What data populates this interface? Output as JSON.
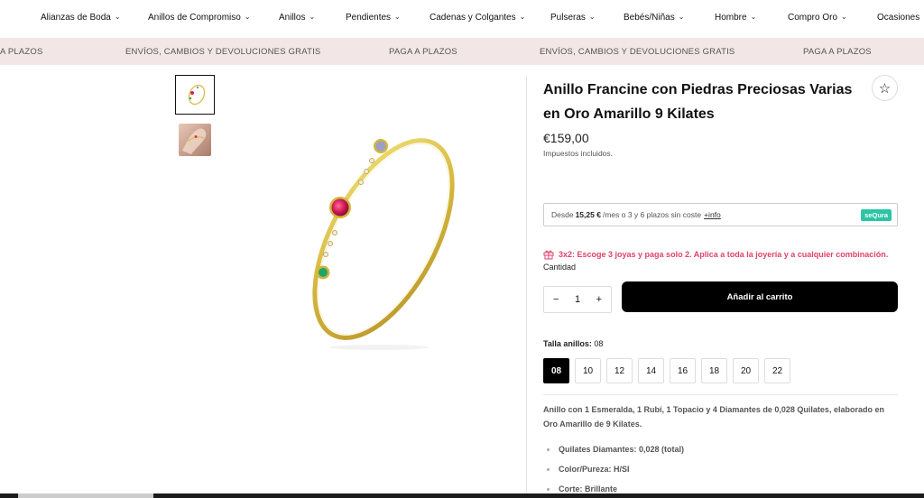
{
  "nav": {
    "items": [
      {
        "label": "Alianzas de Boda"
      },
      {
        "label": "Anillos de Compromiso"
      },
      {
        "label": "Anillos"
      },
      {
        "label": "Pendientes"
      },
      {
        "label": "Cadenas y Colgantes"
      },
      {
        "label": "Pulseras"
      },
      {
        "label": "Bebés/Niñas"
      },
      {
        "label": "Hombre"
      },
      {
        "label": "Compro Oro"
      },
      {
        "label": "Ocasiones"
      }
    ]
  },
  "announcement": {
    "items": [
      "A PLAZOS",
      "ENVÍOS, CAMBIOS Y DEVOLUCIONES GRATIS",
      "PAGA A PLAZOS",
      "ENVÍOS, CAMBIOS Y DEVOLUCIONES GRATIS",
      "PAGA A PLAZOS"
    ]
  },
  "product": {
    "title": "Anillo Francine con Piedras Preciosas Varias en Oro Amarillo 9 Kilates",
    "price": "€159,00",
    "tax_note": "Impuestos incluidos.",
    "sequra": {
      "prefix": "Desde",
      "amount": "15,25 €",
      "suffix": "/mes o 3 y 6 plazos sin coste",
      "info": "+info",
      "logo": "seQura"
    },
    "promo": "3x2: Escoge 3 joyas y paga solo 2. Aplica a toda la joyería y a cualquier combinación.",
    "quantity_label": "Cantidad",
    "quantity": "1",
    "minus": "−",
    "plus": "+",
    "add_to_cart": "Añadir al carrito",
    "size_label": "Talla anillos:",
    "size_selected": "08",
    "sizes": [
      "08",
      "10",
      "12",
      "14",
      "16",
      "18",
      "20",
      "22"
    ],
    "description": "Anillo con 1 Esmeralda, 1 Rubí, 1 Topacio y 4 Diamantes de 0,028 Quilates, elaborado en Oro Amarillo de 9 Kilates.",
    "specs": [
      "Quilates Diamantes: 0,028 (total)",
      "Color/Pureza: H/SI",
      "Corte: Brillante"
    ]
  },
  "colors": {
    "accent_promo": "#e0426a",
    "announcement_bg": "#f2e6e6",
    "sequra": "#2bc5a5",
    "gold": "#d9c14a"
  },
  "icons": {
    "wishlist": "star-outline-icon",
    "promo": "gift-icon",
    "nav_dropdown": "chevron-down-icon"
  }
}
